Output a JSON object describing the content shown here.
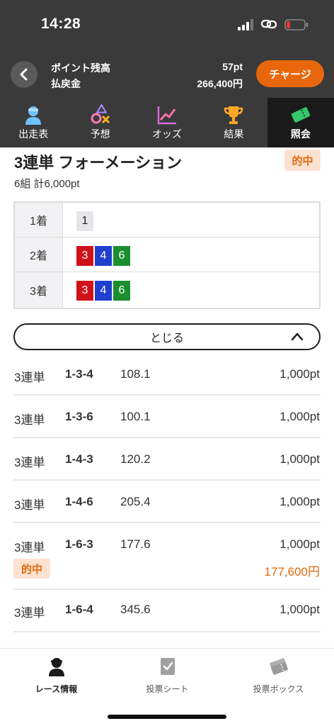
{
  "status": {
    "time": "14:28"
  },
  "points": {
    "balance_label": "ポイント残高",
    "balance_value": "57pt",
    "refund_label": "払戻金",
    "refund_value": "266,400円",
    "charge_label": "チャージ"
  },
  "tabs": [
    {
      "label": "出走表",
      "icon": "racer-icon"
    },
    {
      "label": "予想",
      "icon": "prediction-icon"
    },
    {
      "label": "オッズ",
      "icon": "odds-chart-icon"
    },
    {
      "label": "結果",
      "icon": "trophy-icon"
    },
    {
      "label": "照会",
      "icon": "ticket-icon",
      "active": true
    }
  ],
  "bet": {
    "title": "3連単 フォーメーション",
    "hit_badge": "的中",
    "summary": "6組 計6,000pt",
    "formation": [
      {
        "label": "1着",
        "numbers": [
          "1"
        ]
      },
      {
        "label": "2着",
        "numbers": [
          "3",
          "4",
          "6"
        ]
      },
      {
        "label": "3着",
        "numbers": [
          "3",
          "4",
          "6"
        ]
      }
    ],
    "close_label": "とじる"
  },
  "bets": [
    {
      "type": "3連単",
      "combo": "1-3-4",
      "odds": "108.1",
      "amount": "1,000pt"
    },
    {
      "type": "3連単",
      "combo": "1-3-6",
      "odds": "100.1",
      "amount": "1,000pt"
    },
    {
      "type": "3連単",
      "combo": "1-4-3",
      "odds": "120.2",
      "amount": "1,000pt"
    },
    {
      "type": "3連単",
      "combo": "1-4-6",
      "odds": "205.4",
      "amount": "1,000pt"
    },
    {
      "type": "3連単",
      "combo": "1-6-3",
      "odds": "177.6",
      "amount": "1,000pt",
      "hit": "的中",
      "payout": "177,600円"
    },
    {
      "type": "3連単",
      "combo": "1-6-4",
      "odds": "345.6",
      "amount": "1,000pt"
    }
  ],
  "bottom_nav": [
    {
      "label": "レース情報",
      "icon": "racer-icon",
      "active": true
    },
    {
      "label": "投票シート",
      "icon": "checklist-icon"
    },
    {
      "label": "投票ボックス",
      "icon": "tickets-icon"
    }
  ],
  "colors": {
    "accent": "#e8670c",
    "header_bg": "#3a3a3a",
    "hit_text": "#e06a10",
    "hit_bg": "#fde1cf",
    "box_red": "#d0121b",
    "box_blue": "#1f3fcf",
    "box_green": "#1b8f2e"
  }
}
